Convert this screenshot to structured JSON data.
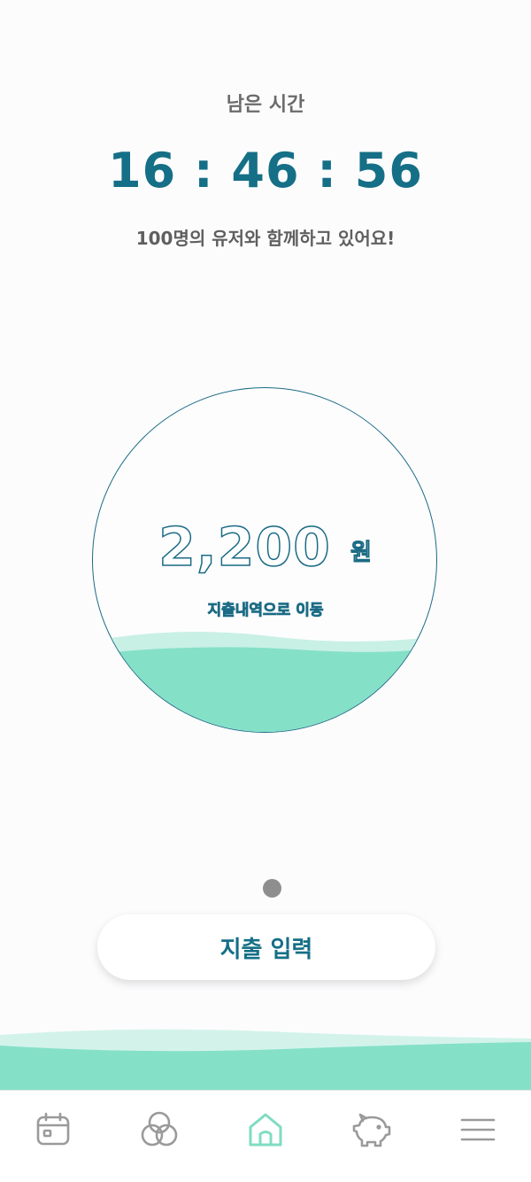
{
  "timer": {
    "label": "남은 시간",
    "value": "16 : 46 : 56"
  },
  "users_text": "100명의 유저와 함께하고 있어요!",
  "gauge": {
    "amount": "2,200",
    "unit": "원",
    "link_label": "지출내역으로 이동",
    "fill_level": 0.28,
    "colors": {
      "outline": "#1b6b84",
      "water": "#85e0c8",
      "water_light": "#c9f0e5"
    }
  },
  "pager": {
    "current": 1,
    "total": 1
  },
  "expense_button_label": "지출 입력",
  "tabs": [
    {
      "name": "calendar-icon",
      "active": false
    },
    {
      "name": "venn-circles-icon",
      "active": false
    },
    {
      "name": "home-icon",
      "active": true
    },
    {
      "name": "piggy-bank-icon",
      "active": false
    },
    {
      "name": "menu-icon",
      "active": false
    }
  ],
  "colors": {
    "accent": "#156f86",
    "active_tab": "#7fdcc2",
    "inactive_tab": "#9a9a9a"
  }
}
